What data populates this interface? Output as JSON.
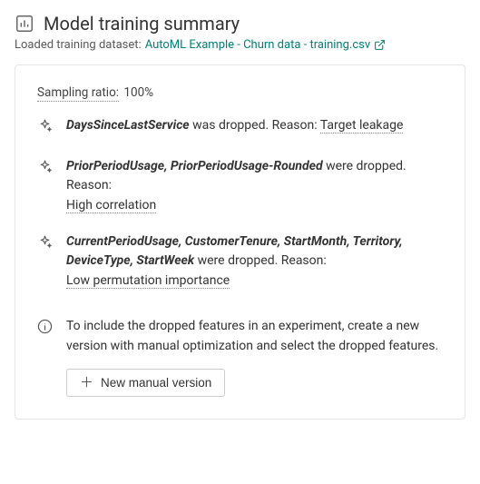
{
  "header": {
    "title": "Model training summary",
    "loaded_label": "Loaded training dataset:",
    "dataset_name": "AutoML Example - Churn data - training.csv"
  },
  "sampling": {
    "label": "Sampling ratio:",
    "value": "100%"
  },
  "drops": [
    {
      "features": "DaysSinceLastService",
      "tail": " was dropped. Reason: ",
      "reason": "Target leakage",
      "reason_inline": true
    },
    {
      "features": "PriorPeriodUsage, PriorPeriodUsage-Rounded",
      "tail": " were dropped. Reason:",
      "reason": "High correlation",
      "reason_inline": false
    },
    {
      "features": "CurrentPeriodUsage, CustomerTenure, StartMonth, Territory, DeviceType, StartWeek",
      "tail": " were dropped. Reason:",
      "reason": "Low permutation importance",
      "reason_inline": false
    }
  ],
  "info": {
    "text": "To include the dropped features in an experiment, create a new version with manual optimization and select the dropped features.",
    "button_label": "New manual version"
  }
}
